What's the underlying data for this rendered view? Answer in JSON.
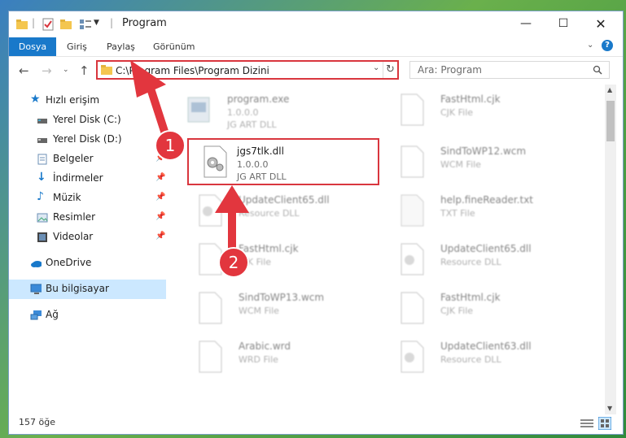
{
  "window": {
    "title": "Program"
  },
  "ribbon": {
    "tabs": [
      "Dosya",
      "Giriş",
      "Paylaş",
      "Görünüm"
    ]
  },
  "address": {
    "path": "C:\\Program Files\\Program Dizini"
  },
  "search": {
    "placeholder": "Ara: Program"
  },
  "sidebar": {
    "items": [
      {
        "label": "Hızlı erişim"
      },
      {
        "label": "Yerel Disk (C:)"
      },
      {
        "label": "Yerel Disk (D:)"
      },
      {
        "label": "Belgeler"
      },
      {
        "label": "İndirmeler"
      },
      {
        "label": "Müzik"
      },
      {
        "label": "Resimler"
      },
      {
        "label": "Videolar"
      },
      {
        "label": "OneDrive"
      },
      {
        "label": "Bu bilgisayar"
      },
      {
        "label": "Ağ"
      }
    ]
  },
  "files": [
    {
      "name": "program.exe",
      "version": "1.0.0.0",
      "type": "JG ART DLL"
    },
    {
      "name": "jgs7tlk.dll",
      "version": "1.0.0.0",
      "type": "JG ART DLL"
    },
    {
      "name": "UpdateClient65.dll",
      "version": "",
      "type": "Resource DLL"
    },
    {
      "name": "FastHtml.cjk",
      "version": "",
      "type": "CJK File"
    },
    {
      "name": "SindToWP13.wcm",
      "version": "",
      "type": "WCM File"
    },
    {
      "name": "Arabic.wrd",
      "version": "",
      "type": "WRD File"
    },
    {
      "name": "FastHtml.cjk",
      "version": "",
      "type": "CJK File"
    },
    {
      "name": "SindToWP12.wcm",
      "version": "",
      "type": "WCM File"
    },
    {
      "name": "help.fineReader.txt",
      "version": "",
      "type": "TXT File"
    },
    {
      "name": "UpdateClient65.dll",
      "version": "",
      "type": "Resource DLL"
    },
    {
      "name": "FastHtml.cjk",
      "version": "",
      "type": "CJK File"
    },
    {
      "name": "UpdateClient63.dll",
      "version": "",
      "type": "Resource DLL"
    }
  ],
  "status": {
    "count": "157 öğe"
  },
  "annotations": {
    "one": "1",
    "two": "2"
  },
  "colors": {
    "accent": "#1979ca",
    "highlight": "#d9363e",
    "selection": "#cce8ff"
  }
}
